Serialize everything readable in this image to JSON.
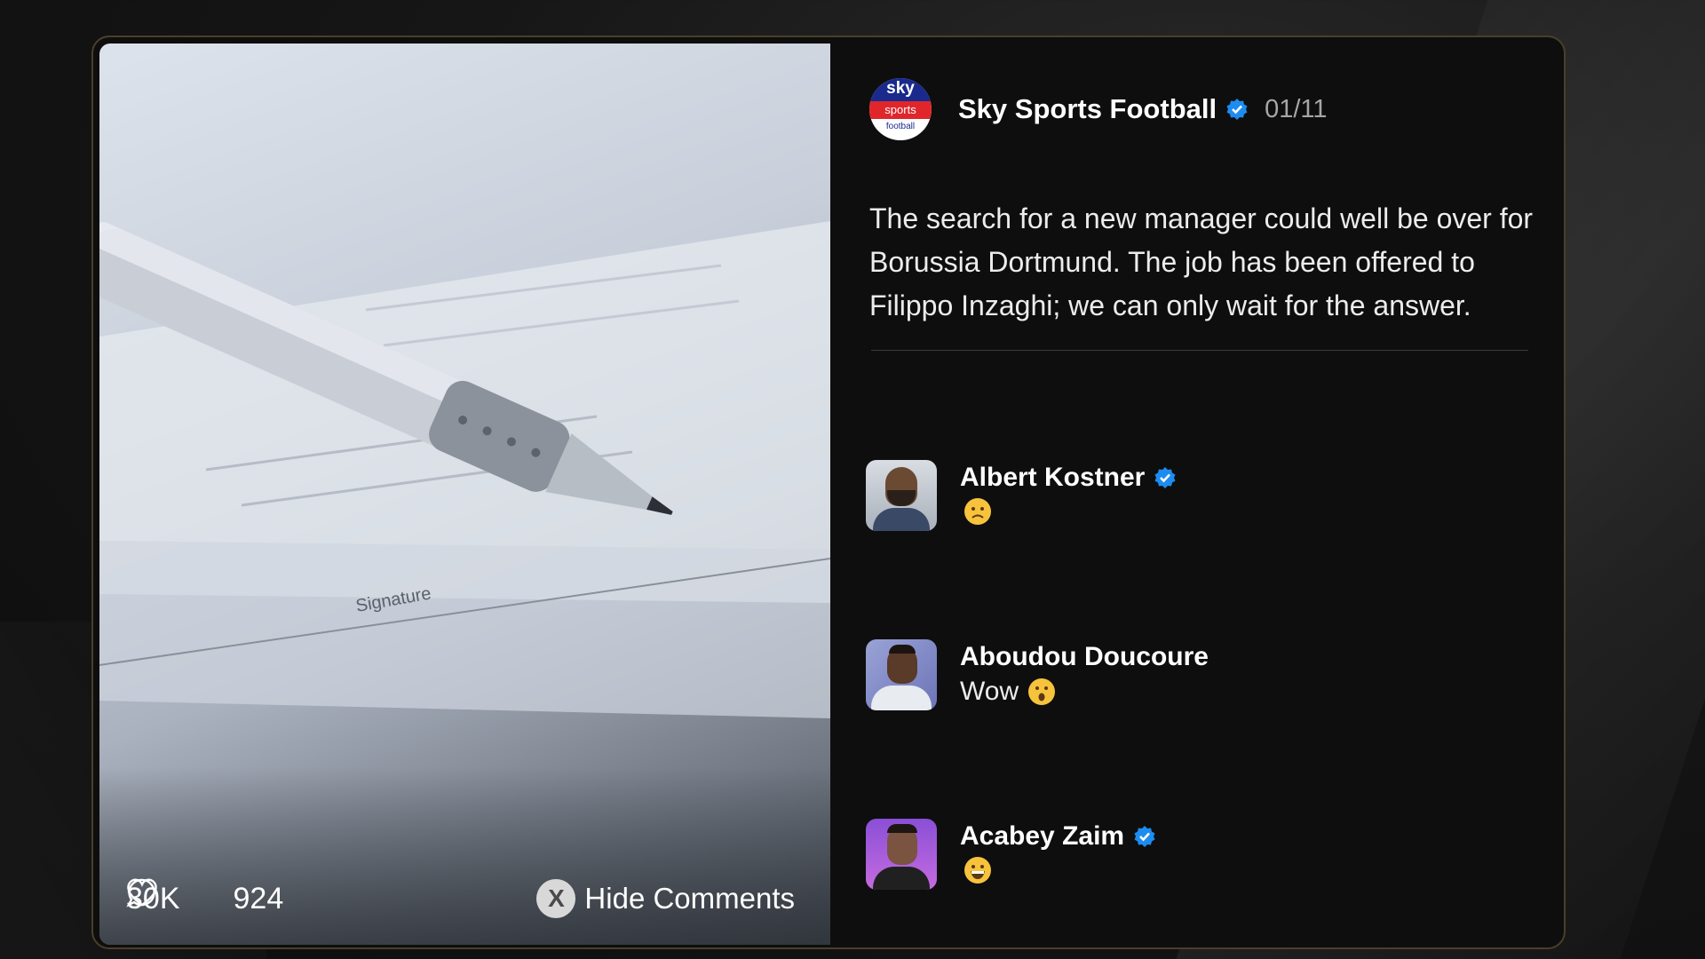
{
  "post": {
    "author": "Sky Sports Football",
    "date": "01/11",
    "text": "The search for a new manager could well be over for Borussia Dortmund. The job has been offered to Filippo Inzaghi; we can only wait for the answer.",
    "logo": {
      "line1": "sky",
      "line2": "sports",
      "line3": "football"
    },
    "image_text": "Signature"
  },
  "stats": {
    "likes": "30K",
    "comments": "924",
    "hide_label": "Hide Comments",
    "hide_button_glyph": "X"
  },
  "comments": [
    {
      "name": "Albert Kostner",
      "verified": true,
      "text": "",
      "emoji": "slightly-frowning-face"
    },
    {
      "name": "Aboudou Doucoure",
      "verified": false,
      "text": "Wow",
      "emoji": "astonished-face"
    },
    {
      "name": "Acabey Zaim",
      "verified": true,
      "text": "",
      "emoji": "grinning-face"
    }
  ],
  "colors": {
    "verified": "#1d8cf0",
    "card_border": "#4a3f2a"
  }
}
